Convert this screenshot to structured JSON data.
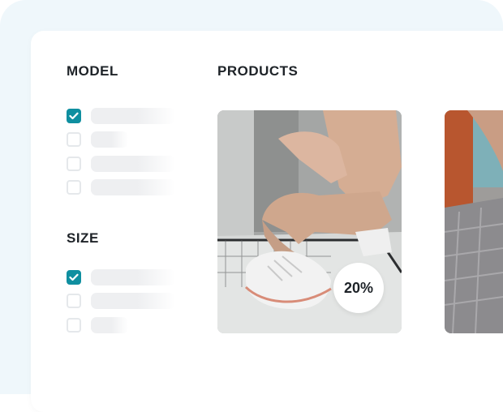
{
  "filters": {
    "model": {
      "heading": "MODEL",
      "options": [
        {
          "checked": true
        },
        {
          "checked": false
        },
        {
          "checked": false
        },
        {
          "checked": false
        }
      ]
    },
    "size": {
      "heading": "SIZE",
      "options": [
        {
          "checked": true
        },
        {
          "checked": false
        },
        {
          "checked": false
        }
      ]
    }
  },
  "products": {
    "heading": "PRODUCTS",
    "items": [
      {
        "badge": "20%"
      },
      {
        "badge": ""
      }
    ]
  },
  "colors": {
    "accent": "#0f8fa0",
    "page_bg": "#eff7fb",
    "card_bg": "#ffffff",
    "text": "#1e2328",
    "placeholder": "#eeeff1"
  },
  "icons": {
    "checkmark": "check-icon"
  }
}
